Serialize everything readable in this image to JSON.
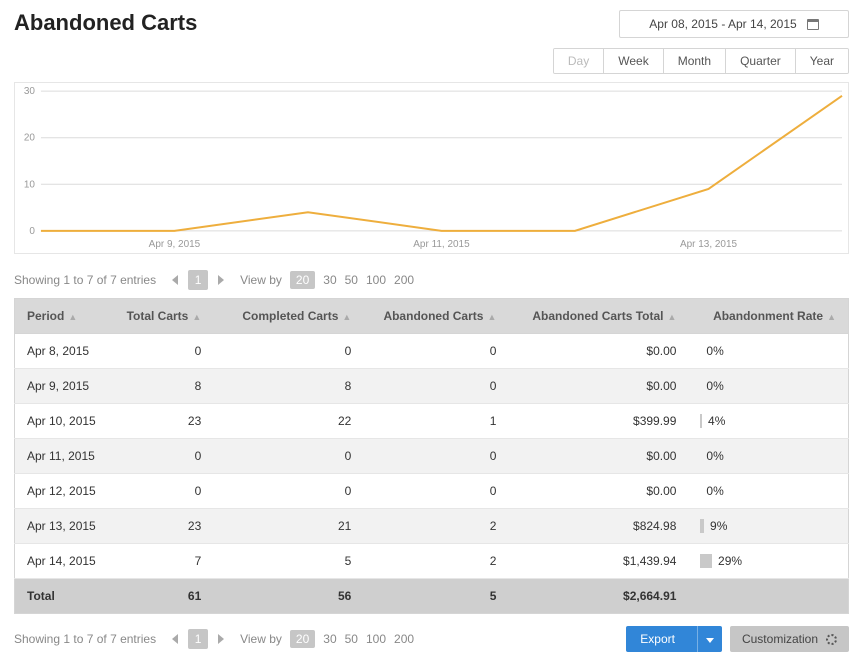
{
  "header": {
    "title": "Abandoned Carts",
    "date_range": "Apr 08, 2015 - Apr 14, 2015",
    "period_tabs": [
      "Day",
      "Week",
      "Month",
      "Quarter",
      "Year"
    ],
    "period_active": "Day"
  },
  "chart_data": {
    "type": "line",
    "title": "",
    "xlabel": "",
    "ylabel": "",
    "ylim": [
      0,
      30
    ],
    "yticks": [
      0,
      10,
      20,
      30
    ],
    "categories": [
      "Apr 8, 2015",
      "Apr 9, 2015",
      "Apr 10, 2015",
      "Apr 11, 2015",
      "Apr 12, 2015",
      "Apr 13, 2015",
      "Apr 14, 2015"
    ],
    "xtick_labels": [
      "Apr 9, 2015",
      "Apr 11, 2015",
      "Apr 13, 2015"
    ],
    "xtick_positions": [
      1,
      3,
      5
    ],
    "series": [
      {
        "name": "Abandonment Rate (%)",
        "color": "#eeae3d",
        "values": [
          0,
          0,
          4,
          0,
          0,
          9,
          29
        ]
      }
    ]
  },
  "pager": {
    "info": "Showing 1 to 7 of 7 entries",
    "page": "1",
    "viewby_label": "View by",
    "viewby_options": [
      "20",
      "30",
      "50",
      "100",
      "200"
    ],
    "viewby_active": "20"
  },
  "table": {
    "columns": [
      {
        "key": "period",
        "label": "Period"
      },
      {
        "key": "total_carts",
        "label": "Total Carts"
      },
      {
        "key": "completed_carts",
        "label": "Completed Carts"
      },
      {
        "key": "abandoned_carts",
        "label": "Abandoned Carts"
      },
      {
        "key": "abandoned_total",
        "label": "Abandoned Carts Total"
      },
      {
        "key": "abandonment_rate",
        "label": "Abandonment Rate"
      }
    ],
    "rows": [
      {
        "period": "Apr 8, 2015",
        "total_carts": 0,
        "completed_carts": 0,
        "abandoned_carts": 0,
        "abandoned_total": "$0.00",
        "abandonment_rate": "0%",
        "rate_num": 0
      },
      {
        "period": "Apr 9, 2015",
        "total_carts": 8,
        "completed_carts": 8,
        "abandoned_carts": 0,
        "abandoned_total": "$0.00",
        "abandonment_rate": "0%",
        "rate_num": 0
      },
      {
        "period": "Apr 10, 2015",
        "total_carts": 23,
        "completed_carts": 22,
        "abandoned_carts": 1,
        "abandoned_total": "$399.99",
        "abandonment_rate": "4%",
        "rate_num": 4
      },
      {
        "period": "Apr 11, 2015",
        "total_carts": 0,
        "completed_carts": 0,
        "abandoned_carts": 0,
        "abandoned_total": "$0.00",
        "abandonment_rate": "0%",
        "rate_num": 0
      },
      {
        "period": "Apr 12, 2015",
        "total_carts": 0,
        "completed_carts": 0,
        "abandoned_carts": 0,
        "abandoned_total": "$0.00",
        "abandonment_rate": "0%",
        "rate_num": 0
      },
      {
        "period": "Apr 13, 2015",
        "total_carts": 23,
        "completed_carts": 21,
        "abandoned_carts": 2,
        "abandoned_total": "$824.98",
        "abandonment_rate": "9%",
        "rate_num": 9
      },
      {
        "period": "Apr 14, 2015",
        "total_carts": 7,
        "completed_carts": 5,
        "abandoned_carts": 2,
        "abandoned_total": "$1,439.94",
        "abandonment_rate": "29%",
        "rate_num": 29
      }
    ],
    "totals": {
      "label": "Total",
      "total_carts": 61,
      "completed_carts": 56,
      "abandoned_carts": 5,
      "abandoned_total": "$2,664.91"
    }
  },
  "footer": {
    "export_label": "Export",
    "customize_label": "Customization"
  }
}
